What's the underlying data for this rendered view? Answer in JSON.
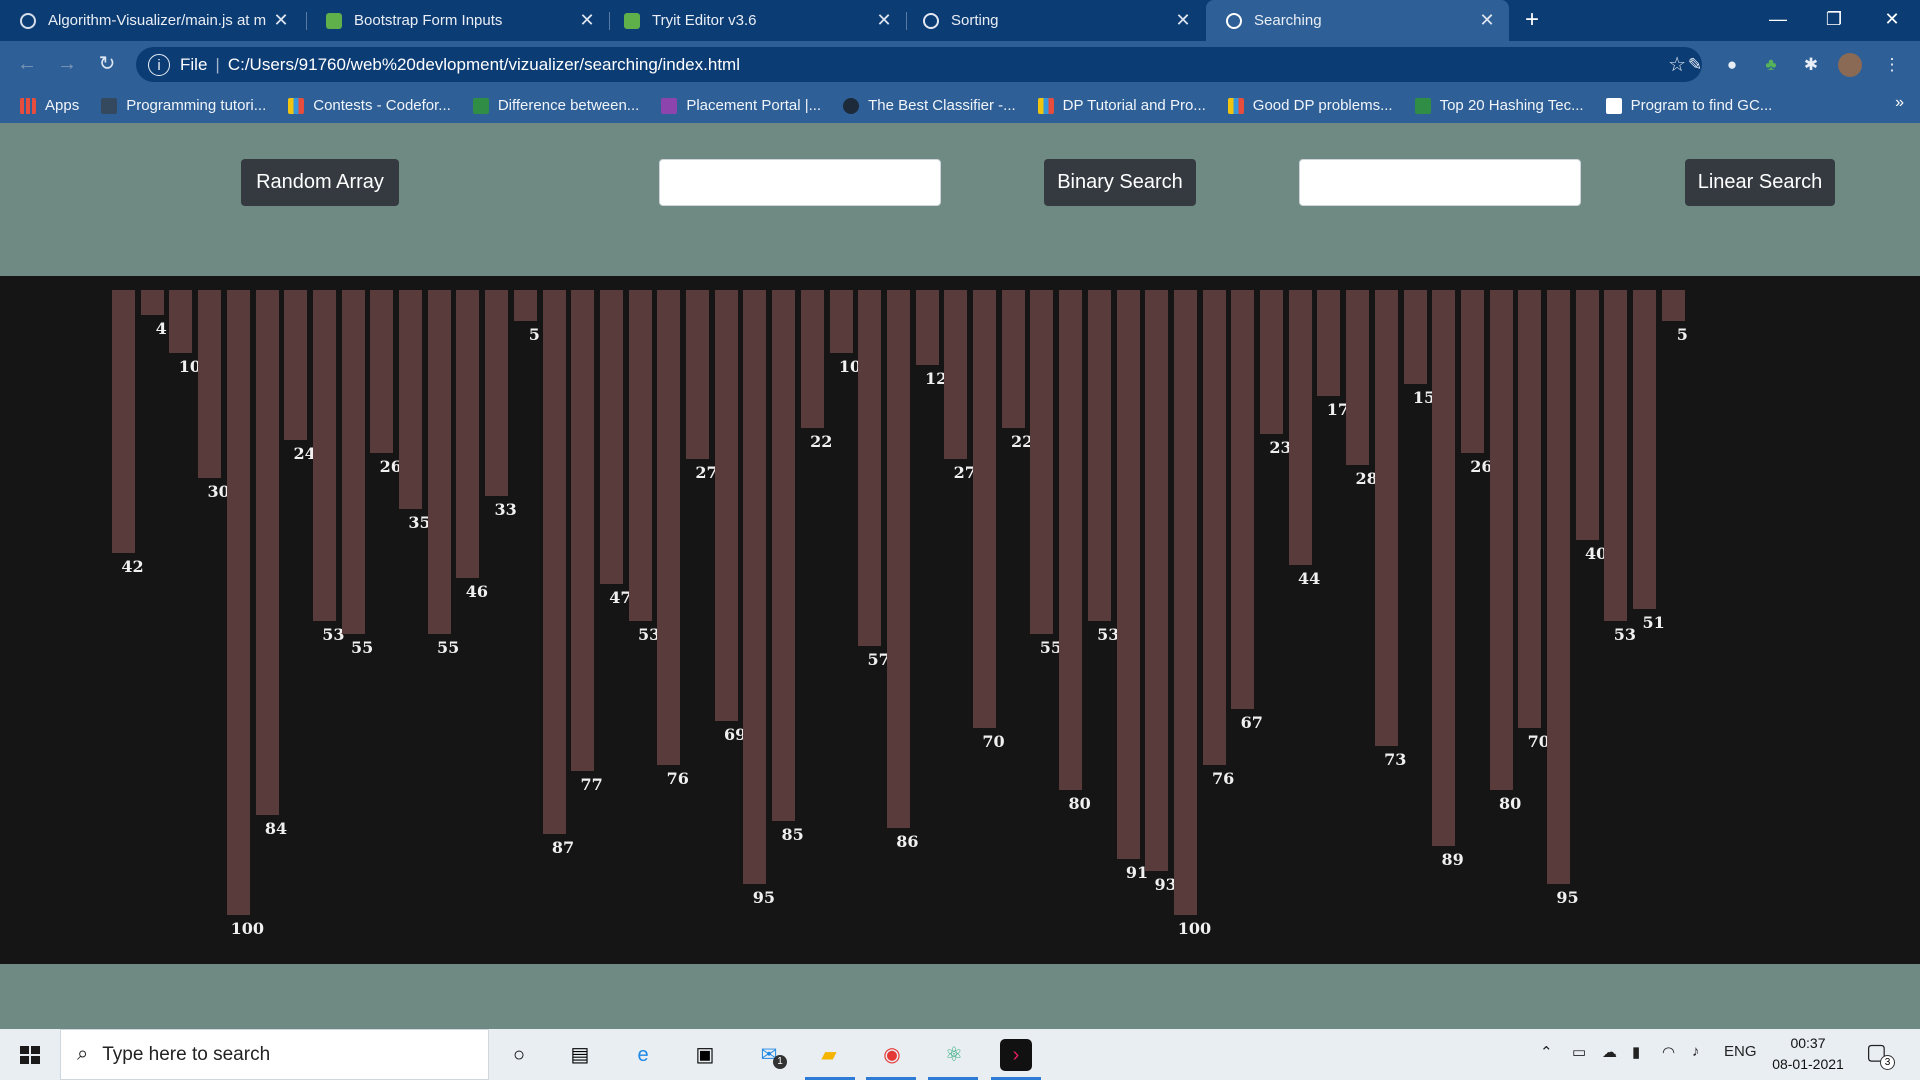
{
  "browser": {
    "tabs": [
      {
        "title": "Algorithm-Visualizer/main.js at m",
        "icon": "github-icon",
        "active": false
      },
      {
        "title": "Bootstrap Form Inputs",
        "icon": "w3schools-icon",
        "active": false
      },
      {
        "title": "Tryit Editor v3.6",
        "icon": "w3schools-icon",
        "active": false
      },
      {
        "title": "Sorting",
        "icon": "globe-icon",
        "active": false
      },
      {
        "title": "Searching",
        "icon": "globe-icon",
        "active": true
      }
    ],
    "address": {
      "scheme": "File",
      "url": "C:/Users/91760/web%20devlopment/vizualizer/searching/index.html"
    },
    "bookmarks": [
      {
        "label": "Apps",
        "icon": "apps-grid-icon"
      },
      {
        "label": "Programming tutori...",
        "icon": "bookmark-icon"
      },
      {
        "label": "Contests - Codefor...",
        "icon": "codeforces-icon"
      },
      {
        "label": "Difference between...",
        "icon": "geeksforgeeks-icon"
      },
      {
        "label": "Placement Portal |...",
        "icon": "list-icon"
      },
      {
        "label": "The Best Classifier -...",
        "icon": "bulb-icon"
      },
      {
        "label": "DP Tutorial and Pro...",
        "icon": "codeforces-icon"
      },
      {
        "label": "Good DP problems...",
        "icon": "codeforces-icon"
      },
      {
        "label": "Top 20 Hashing Tec...",
        "icon": "geeksforgeeks-icon"
      },
      {
        "label": "Program to find GC...",
        "icon": "geeksforgeeks-icon"
      }
    ],
    "more_chevron": "»"
  },
  "page": {
    "random_array_label": "Random Array",
    "binary_search_label": "Binary Search",
    "linear_search_label": "Linear Search",
    "binary_input_value": "",
    "linear_input_value": ""
  },
  "chart_data": {
    "type": "bar",
    "orientation": "downward",
    "values": [
      42,
      4,
      10,
      30,
      100,
      84,
      24,
      53,
      55,
      26,
      35,
      55,
      46,
      33,
      5,
      87,
      77,
      47,
      53,
      76,
      27,
      69,
      95,
      85,
      22,
      10,
      57,
      86,
      12,
      27,
      70,
      22,
      55,
      80,
      53,
      91,
      93,
      100,
      76,
      67,
      23,
      44,
      17,
      28,
      73,
      15,
      89,
      26,
      80,
      70,
      95,
      40,
      53,
      51,
      5
    ],
    "ylim": [
      0,
      100
    ],
    "bar_color": "#5a3b3c",
    "background": "#151515"
  },
  "taskbar": {
    "search_placeholder": "Type here to search",
    "mail_badge": "1",
    "language": "ENG",
    "time": "00:37",
    "date": "08-01-2021",
    "notification_count": "3"
  },
  "colors": {
    "page_bg": "#6e8a83",
    "tab_bar": "#0c3c74",
    "toolbar": "#2e5f96",
    "button_dark": "#343a40"
  }
}
